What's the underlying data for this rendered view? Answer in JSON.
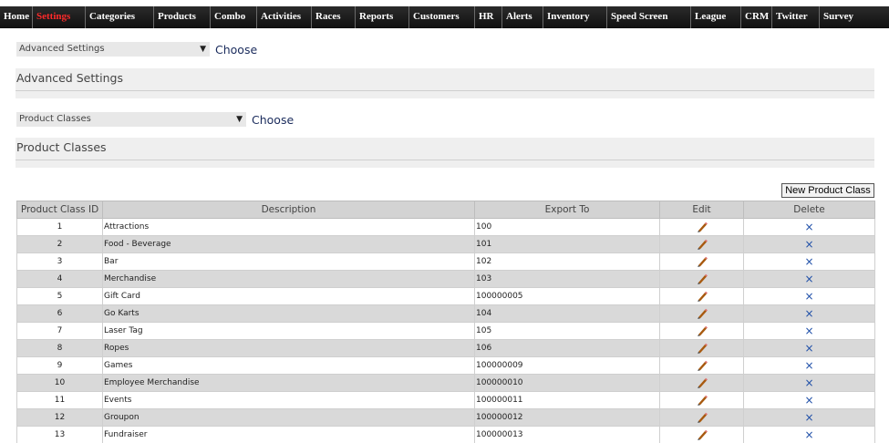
{
  "nav": {
    "items": [
      {
        "label": "Home"
      },
      {
        "label": "Settings"
      },
      {
        "label": "Categories"
      },
      {
        "label": "Products"
      },
      {
        "label": "Combo"
      },
      {
        "label": "Activities"
      },
      {
        "label": "Races"
      },
      {
        "label": "Reports"
      },
      {
        "label": "Customers"
      },
      {
        "label": "HR"
      },
      {
        "label": "Alerts"
      },
      {
        "label": "Inventory"
      },
      {
        "label": "Speed Screen"
      },
      {
        "label": "League"
      },
      {
        "label": "CRM"
      },
      {
        "label": "Twitter"
      },
      {
        "label": "Survey"
      }
    ],
    "active": "Settings",
    "active_color": "#ff2a2a"
  },
  "settings_select": {
    "value": "Advanced Settings",
    "choose_label": "Choose"
  },
  "advanced_section": {
    "title": "Advanced Settings"
  },
  "class_select": {
    "value": "Product Classes",
    "choose_label": "Choose"
  },
  "classes_section": {
    "title": "Product Classes"
  },
  "new_button_label": "New Product Class",
  "table": {
    "columns": [
      "Product Class ID",
      "Description",
      "Export To",
      "Edit",
      "Delete"
    ],
    "rows": [
      {
        "id": "1",
        "description": "Attractions",
        "export_to": "100"
      },
      {
        "id": "2",
        "description": "Food - Beverage",
        "export_to": "101"
      },
      {
        "id": "3",
        "description": "Bar",
        "export_to": "102"
      },
      {
        "id": "4",
        "description": "Merchandise",
        "export_to": "103"
      },
      {
        "id": "5",
        "description": "Gift Card",
        "export_to": "100000005"
      },
      {
        "id": "6",
        "description": "Go Karts",
        "export_to": "104"
      },
      {
        "id": "7",
        "description": "Laser Tag",
        "export_to": "105"
      },
      {
        "id": "8",
        "description": "Ropes",
        "export_to": "106"
      },
      {
        "id": "9",
        "description": "Games",
        "export_to": "100000009"
      },
      {
        "id": "10",
        "description": "Employee Merchandise",
        "export_to": "100000010"
      },
      {
        "id": "11",
        "description": "Events",
        "export_to": "100000011"
      },
      {
        "id": "12",
        "description": "Groupon",
        "export_to": "100000012"
      },
      {
        "id": "13",
        "description": "Fundraiser",
        "export_to": "100000013"
      }
    ],
    "edit_icon": "pencil-icon",
    "delete_icon": "close-icon",
    "delete_glyph": "×",
    "delete_color": "#1f4fa8"
  }
}
